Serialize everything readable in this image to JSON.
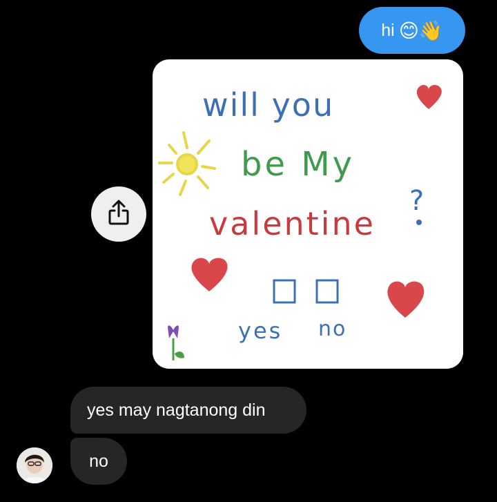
{
  "outgoing": {
    "text": "hi",
    "emojis": "😊👋"
  },
  "image": {
    "line1": "will you",
    "line2": "be My",
    "line3": "valentine",
    "question_mark": "?",
    "option_yes": "yes",
    "option_no": "no"
  },
  "share_button": {
    "icon": "share-icon"
  },
  "incoming": [
    {
      "text": "yes may nagtanong din"
    },
    {
      "text": "no"
    }
  ],
  "colors": {
    "background": "#000000",
    "outgoing_bubble": "#3797f0",
    "incoming_bubble": "#262626",
    "text": "#ffffff"
  }
}
